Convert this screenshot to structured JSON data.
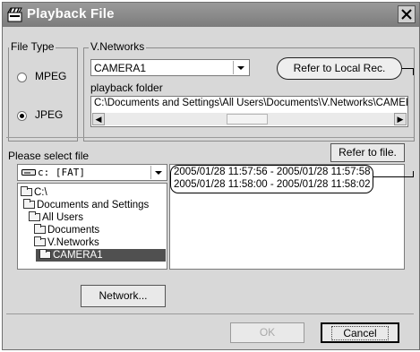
{
  "window": {
    "title": "Playback File"
  },
  "file_type": {
    "legend": "File Type",
    "options": [
      {
        "label": "MPEG",
        "selected": false
      },
      {
        "label": "JPEG",
        "selected": true
      }
    ]
  },
  "vnetworks": {
    "legend": "V.Networks",
    "camera_value": "CAMERA1",
    "refer_local_label": "Refer to Local Rec.",
    "playback_folder_label": "playback folder",
    "playback_folder_path": "C:\\Documents and Settings\\All Users\\Documents\\V.Networks\\CAMERA"
  },
  "file_select": {
    "label": "Please select file",
    "refer_file_label": "Refer to file.",
    "drive_value": "c: [FAT]",
    "tree": [
      {
        "label": "C:\\",
        "selected": false
      },
      {
        "label": "Documents and Settings",
        "selected": false
      },
      {
        "label": "All Users",
        "selected": false
      },
      {
        "label": "Documents",
        "selected": false
      },
      {
        "label": "V.Networks",
        "selected": false
      },
      {
        "label": "CAMERA1",
        "selected": true
      }
    ],
    "files": [
      "2005/01/28 11:57:56 - 2005/01/28 11:57:58",
      "2005/01/28 11:58:00 - 2005/01/28 11:58:02"
    ]
  },
  "buttons": {
    "network_label": "Network...",
    "ok_label": "OK",
    "cancel_label": "Cancel"
  }
}
